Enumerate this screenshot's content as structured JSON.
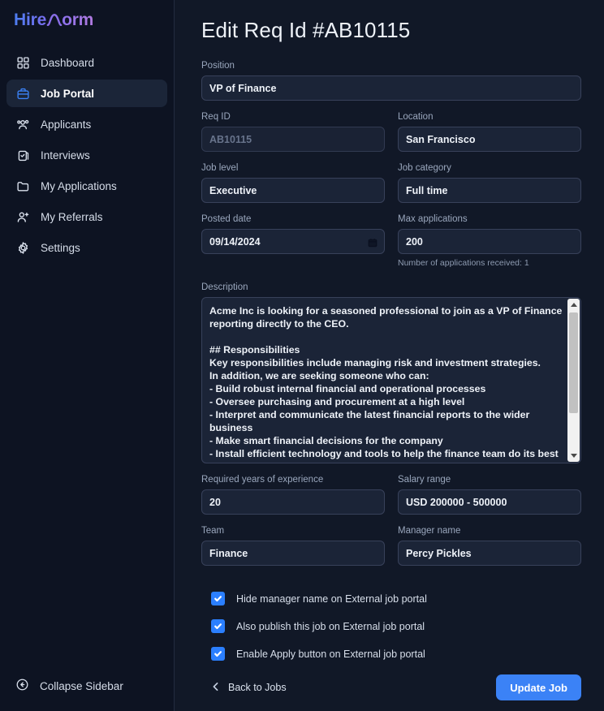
{
  "brand": {
    "name_part1": "Hire",
    "name_part2": "orm",
    "icon": "peak-n-logo"
  },
  "sidebar": {
    "items": [
      {
        "label": "Dashboard",
        "icon": "grid-icon",
        "active": false
      },
      {
        "label": "Job Portal",
        "icon": "briefcase-icon",
        "active": true
      },
      {
        "label": "Applicants",
        "icon": "users-icon",
        "active": false
      },
      {
        "label": "Interviews",
        "icon": "clipboard-check-icon",
        "active": false
      },
      {
        "label": "My Applications",
        "icon": "folder-icon",
        "active": false
      },
      {
        "label": "My Referrals",
        "icon": "user-plus-icon",
        "active": false
      },
      {
        "label": "Settings",
        "icon": "gear-icon",
        "active": false
      }
    ],
    "collapse_label": "Collapse Sidebar",
    "collapse_icon": "arrow-left-circle-icon"
  },
  "main": {
    "title": "Edit Req Id #AB10115",
    "fields": {
      "position": {
        "label": "Position",
        "value": "VP of Finance"
      },
      "req_id": {
        "label": "Req ID",
        "value": "AB10115",
        "disabled": true
      },
      "location": {
        "label": "Location",
        "value": "San Francisco"
      },
      "job_level": {
        "label": "Job level",
        "value": "Executive"
      },
      "job_category": {
        "label": "Job category",
        "value": "Full time"
      },
      "posted_date": {
        "label": "Posted date",
        "value": "09/14/2024",
        "icon": "calendar-icon"
      },
      "max_apps": {
        "label": "Max applications",
        "value": "200",
        "helper": "Number of applications received: 1"
      },
      "description": {
        "label": "Description",
        "value": "Acme Inc is looking for a seasoned professional to join as a VP of Finance reporting directly to the CEO.\n\n## Responsibilities\nKey responsibilities include managing risk and investment strategies.\nIn addition, we are seeking someone who can:\n- Build robust internal financial and operational processes\n- Oversee purchasing and procurement at a high level\n- Interpret and communicate the latest financial reports to the wider business\n- Make smart financial decisions for the company\n- Install efficient technology and tools to help the finance team do its best work\n- Build a successful, high-functioning finance team"
      },
      "experience": {
        "label": "Required years of experience",
        "value": "20"
      },
      "salary": {
        "label": "Salary range",
        "value": "USD 200000 - 500000"
      },
      "team": {
        "label": "Team",
        "value": "Finance"
      },
      "manager": {
        "label": "Manager name",
        "value": "Percy Pickles"
      }
    },
    "checkboxes": [
      {
        "label": "Hide manager name on External job portal",
        "checked": true
      },
      {
        "label": "Also publish this job on External job portal",
        "checked": true
      },
      {
        "label": "Enable Apply button on External job portal",
        "checked": true
      }
    ],
    "footer": {
      "back_label": "Back to Jobs",
      "back_icon": "chevron-left-icon",
      "submit_label": "Update Job"
    }
  },
  "colors": {
    "accent": "#3b82f6",
    "checkbox": "#2b7fff",
    "sidebar_bg": "#0d1322",
    "main_bg": "#111827",
    "input_bg": "#1b2437",
    "input_border": "#38415a"
  }
}
